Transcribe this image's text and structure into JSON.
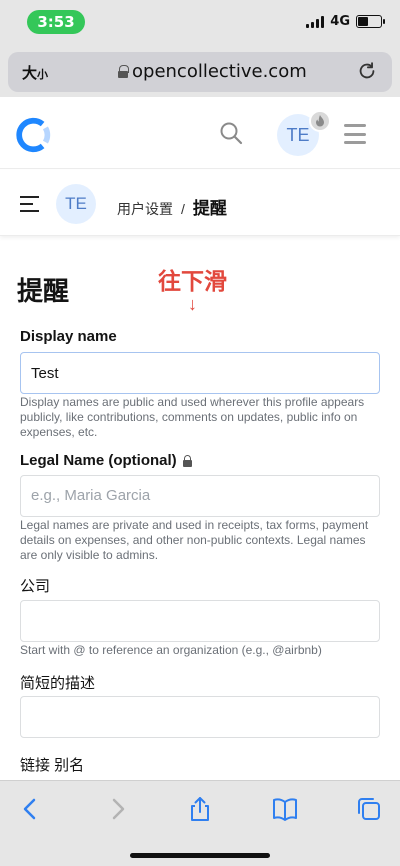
{
  "status_bar": {
    "time": "3:53",
    "network": "4G"
  },
  "browser": {
    "font_size_label": "大",
    "font_size_small": "小",
    "url": "opencollective.com"
  },
  "site_header": {
    "avatar_initials": "TE"
  },
  "breadcrumb": {
    "avatar_initials": "TE",
    "parent": "用户设置",
    "separator": "/",
    "current": "提醒"
  },
  "page": {
    "title": "提醒",
    "annotation": "往下滑",
    "annotation_arrow": "↓"
  },
  "form": {
    "display_name": {
      "label": "Display name",
      "value": "Test",
      "help": "Display names are public and used wherever this profile appears publicly, like contributions, comments on updates, public info on expenses, etc."
    },
    "legal_name": {
      "label": "Legal Name (optional)",
      "placeholder": "e.g., Maria Garcia",
      "help": "Legal names are private and used in receipts, tax forms, payment details on expenses, and other non-public contexts. Legal names are only visible to admins."
    },
    "company": {
      "label": "公司",
      "value": "",
      "help": "Start with @ to reference an organization (e.g., @airbnb)"
    },
    "short_description": {
      "label": "简短的描述",
      "value": ""
    },
    "link_alias": {
      "label": "链接 别名"
    }
  },
  "colors": {
    "accent": "#4e7cc7",
    "annotation": "#e2483d",
    "status_green": "#34c759",
    "logo_blue": "#1f87ff"
  },
  "icons": [
    "lock-icon",
    "reload-icon",
    "search-icon",
    "menu-icon",
    "back-icon",
    "forward-icon",
    "share-icon",
    "bookmarks-icon",
    "tabs-icon"
  ]
}
